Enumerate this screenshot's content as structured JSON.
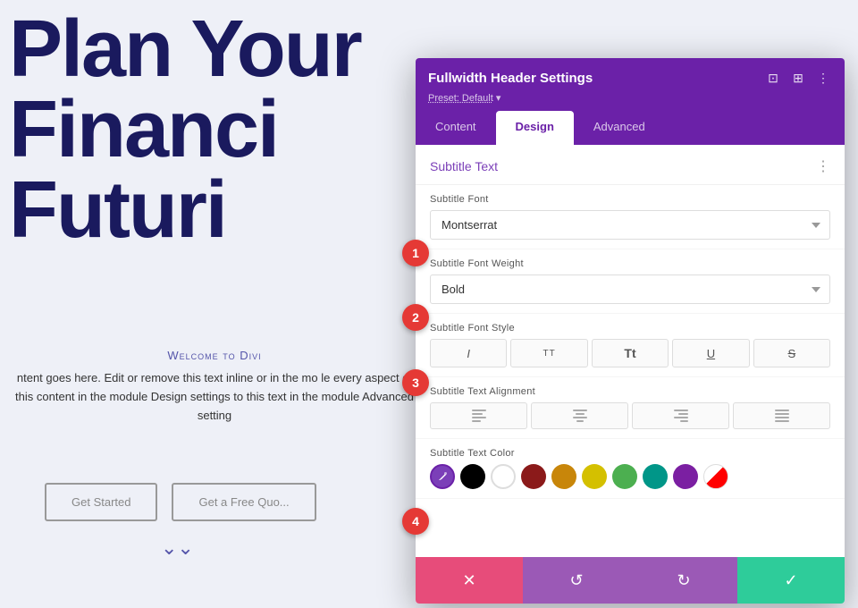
{
  "page": {
    "bg_color": "#eef0f7",
    "hero_text": "Plan Your\nFinanci\nFuturi",
    "welcome_label": "Welcome to Divi",
    "body_text": "ntent goes here. Edit or remove this text inline or in the mo le every aspect of this content in the module Design settings to this text in the module Advanced setting",
    "btn_get_started": "Get Started",
    "btn_free_quote": "Get a Free Quo..."
  },
  "panel": {
    "title": "Fullwidth Header Settings",
    "preset_label": "Preset: Default",
    "tabs": [
      {
        "label": "Content",
        "active": false
      },
      {
        "label": "Design",
        "active": true
      },
      {
        "label": "Advanced",
        "active": false
      }
    ],
    "section": {
      "title": "Subtitle Text"
    },
    "fields": {
      "subtitle_font_label": "Subtitle Font",
      "subtitle_font_value": "Montserrat",
      "subtitle_font_weight_label": "Subtitle Font Weight",
      "subtitle_font_weight_value": "Bold",
      "subtitle_font_style_label": "Subtitle Font Style",
      "subtitle_text_alignment_label": "Subtitle Text Alignment",
      "subtitle_text_color_label": "Subtitle Text Color"
    },
    "style_buttons": [
      "I",
      "TT",
      "Tt",
      "U",
      "S"
    ],
    "color_swatches": [
      {
        "color": "#000000"
      },
      {
        "color": "#ffffff"
      },
      {
        "color": "#8b1a1a"
      },
      {
        "color": "#c8860a"
      },
      {
        "color": "#d4c000"
      },
      {
        "color": "#4caf50"
      },
      {
        "color": "#009688"
      },
      {
        "color": "#7b1fa2"
      },
      {
        "color": "#d81b60"
      }
    ],
    "actions": {
      "cancel": "✕",
      "undo": "↺",
      "redo": "↻",
      "confirm": "✓"
    }
  },
  "badges": [
    {
      "number": "1",
      "field": "subtitle_font"
    },
    {
      "number": "2",
      "field": "subtitle_font_weight"
    },
    {
      "number": "3",
      "field": "subtitle_font_style"
    },
    {
      "number": "4",
      "field": "color_picker"
    }
  ]
}
